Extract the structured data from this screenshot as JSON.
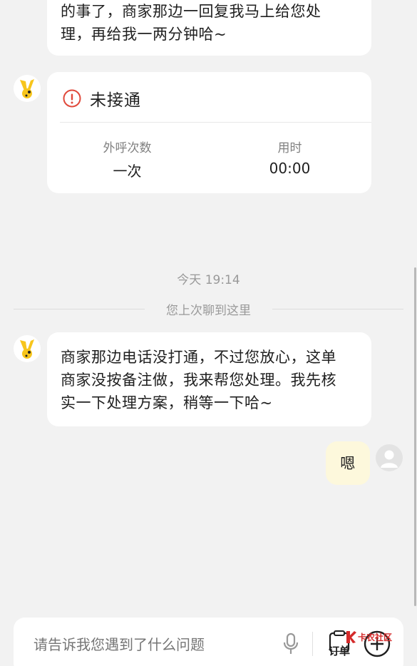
{
  "messages": [
    {
      "text": "的事了，商家那边一回复我马上给您处\n理，再给我一两分钟哈~"
    },
    {
      "call_card": {
        "status": "未接通",
        "stat1_label": "外呼次数",
        "stat1_value": "一次",
        "stat2_label": "用时",
        "stat2_value": "00:00"
      }
    },
    {
      "text": "商家那边电话没打通，不过您放心，这单\n商家没按备注做，我来帮您处理。我先核\n实一下处理方案，稍等一下哈~"
    },
    {
      "user_text": "嗯"
    }
  ],
  "timestamp": "今天 19:14",
  "divider_text": "您上次聊到这里",
  "input": {
    "placeholder": "请告诉我您遇到了什么问题",
    "order_label": "订单"
  },
  "watermark": "卡农社区",
  "colors": {
    "warning": "#e0493b",
    "user_bubble": "#fdf8dc",
    "avatar_yellow": "#f7c51c"
  },
  "icons": [
    "alert-circle-icon",
    "microphone-icon",
    "order-icon",
    "plus-circle-icon",
    "user-avatar-icon",
    "mascot-avatar-icon"
  ]
}
